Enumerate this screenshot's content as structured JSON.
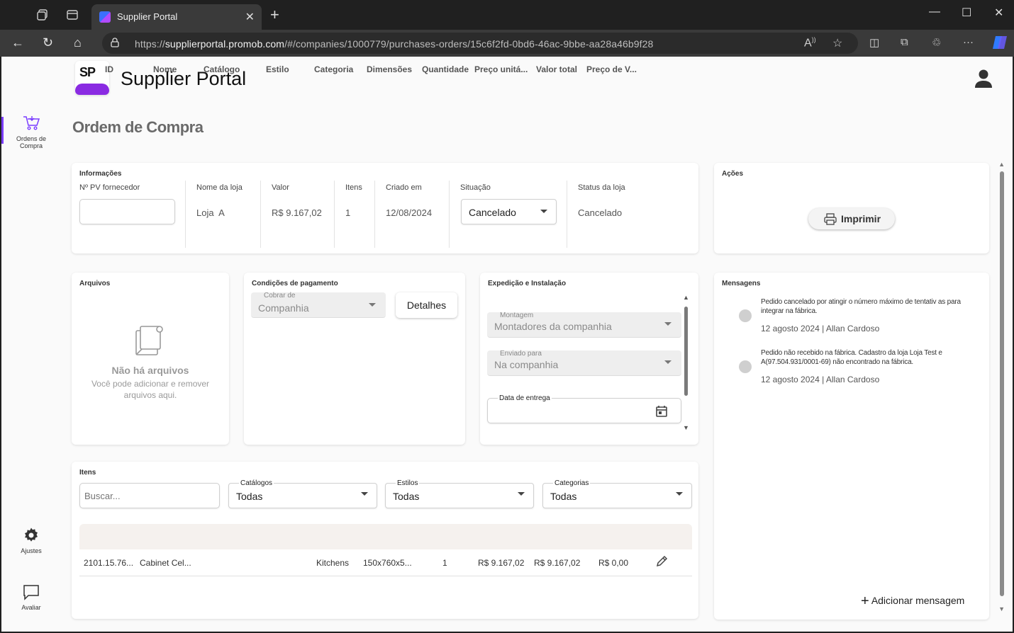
{
  "browser": {
    "tab_title": "Supplier Portal",
    "url_prefix": "https://",
    "url_host": "supplierportal.promob.com",
    "url_path": "/#/companies/1000779/purchases-orders/15c6f2fd-0bd6-46ac-9bbe-aa28a46b9f28"
  },
  "app": {
    "logo_text": "SP",
    "title": "Supplier Portal"
  },
  "sidebar": {
    "orders_label": "Ordens de Compra",
    "settings_label": "Ajustes",
    "rate_label": "Avaliar"
  },
  "page": {
    "title": "Ordem de Compra"
  },
  "info": {
    "section_title": "Informações",
    "supplier_po_label": "Nº PV fornecedor",
    "supplier_po_value": "",
    "store_name_label": "Nome da loja",
    "store_name_value": "Loja  A",
    "value_label": "Valor",
    "value_value": "R$ 9.167,02",
    "items_label": "Itens",
    "items_value": "1",
    "created_label": "Criado em",
    "created_value": "12/08/2024",
    "situation_label": "Situação",
    "situation_value": "Cancelado",
    "store_status_label": "Status da loja",
    "store_status_value": "Cancelado"
  },
  "actions": {
    "section_title": "Ações",
    "print_label": "Imprimir"
  },
  "files": {
    "section_title": "Arquivos",
    "empty_title": "Não há arquivos",
    "empty_desc": "Você pode adicionar e remover arquivos aqui."
  },
  "payment": {
    "section_title": "Condições de pagamento",
    "charge_from_label": "Cobrar de",
    "charge_from_value": "Companhia",
    "details_label": "Detalhes"
  },
  "shipping": {
    "section_title": "Expedição e Instalação",
    "assembly_label": "Montagem",
    "assembly_value": "Montadores da companhia",
    "sent_to_label": "Enviado para",
    "sent_to_value": "Na companhia",
    "delivery_date_label": "Data de entrega",
    "delivery_date_value": ""
  },
  "messages": {
    "section_title": "Mensagens",
    "items": [
      {
        "text": "Pedido cancelado por atingir o número máximo de tentativ as para integrar na fábrica.",
        "meta": "12 agosto 2024 | Allan Cardoso"
      },
      {
        "text": "Pedido não recebido na fábrica. Cadastro da loja Loja Test e A(97.504.931/0001-69) não encontrado na fábrica.",
        "meta": "12 agosto 2024 | Allan Cardoso"
      }
    ],
    "add_label": "Adicionar mensagem"
  },
  "items": {
    "section_title": "Itens",
    "search_placeholder": "Buscar...",
    "catalogs_label": "Catálogos",
    "catalogs_value": "Todas",
    "styles_label": "Estilos",
    "styles_value": "Todas",
    "categories_label": "Categorias",
    "categories_value": "Todas",
    "columns": [
      "ID",
      "Nome",
      "Catálogo",
      "Estilo",
      "Categoria",
      "Dimensões",
      "Quantidade",
      "Preço unitá...",
      "Valor total",
      "Preço de V..."
    ],
    "rows": [
      {
        "id": "2101.15.76...",
        "name": "Cabinet Cel...",
        "catalog": "",
        "style": "",
        "category": "Kitchens",
        "dimensions": "150x760x5...",
        "quantity": "1",
        "unit_price": "R$ 9.167,02",
        "total": "R$ 9.167,02",
        "sale_price": "R$ 0,00"
      }
    ]
  },
  "colors": {
    "accent": "#7a3cff",
    "logo_purple": "#8a2be2",
    "chrome_dark": "#202020"
  }
}
